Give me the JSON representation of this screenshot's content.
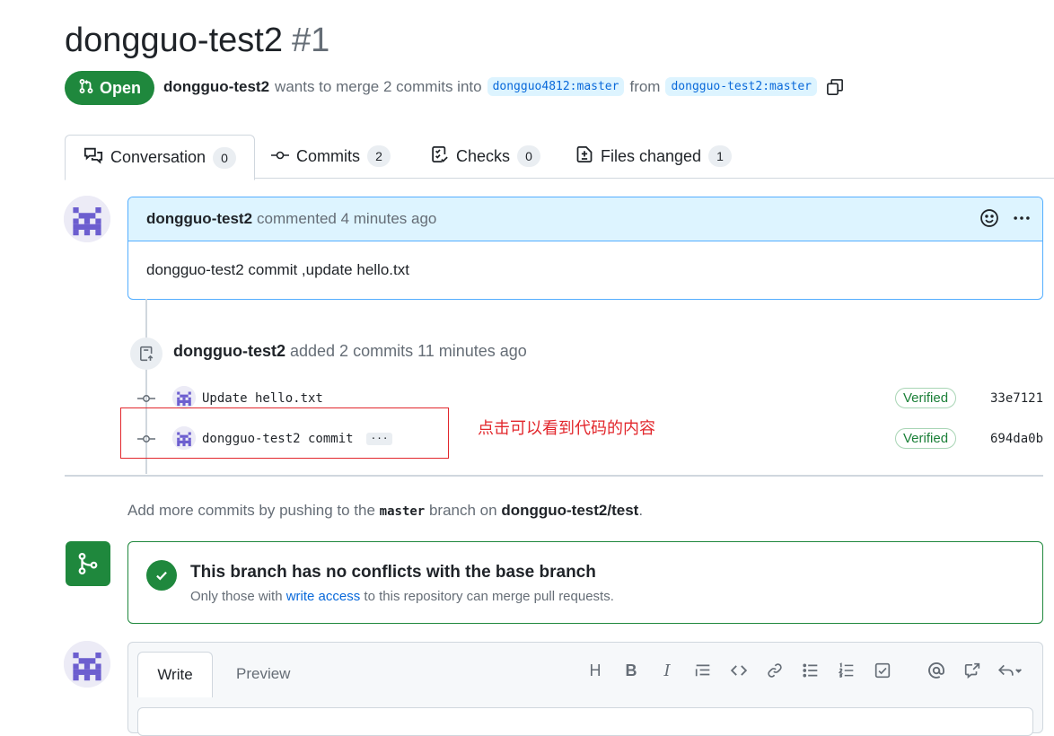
{
  "pr": {
    "title": "dongguo-test2",
    "number": "#1",
    "state": "Open",
    "author": "dongguo-test2",
    "wants_text": "wants to merge 2 commits into",
    "base_branch": "dongguo4812:master",
    "from_text": "from",
    "head_branch": "dongguo-test2:master"
  },
  "tabs": [
    {
      "label": "Conversation",
      "count": "0"
    },
    {
      "label": "Commits",
      "count": "2"
    },
    {
      "label": "Checks",
      "count": "0"
    },
    {
      "label": "Files changed",
      "count": "1"
    }
  ],
  "comment": {
    "author": "dongguo-test2",
    "meta": "commented 4 minutes ago",
    "body": "dongguo-test2 commit ,update hello.txt"
  },
  "event": {
    "author": "dongguo-test2",
    "text": "added 2 commits 11 minutes ago"
  },
  "commits": [
    {
      "message": "Update hello.txt",
      "verified": "Verified",
      "sha": "33e7121"
    },
    {
      "message": "dongguo-test2 commit",
      "verified": "Verified",
      "sha": "694da0b",
      "more": "···"
    }
  ],
  "annotation": "点击可以看到代码的内容",
  "hint": {
    "prefix": "Add more commits by pushing to the",
    "branch": "master",
    "middle": "branch on",
    "repo": "dongguo-test2/test",
    "suffix": "."
  },
  "merge": {
    "title": "This branch has no conflicts with the base branch",
    "sub_prefix": "Only those with",
    "sub_link": "write access",
    "sub_suffix": "to this repository can merge pull requests."
  },
  "editor": {
    "write_tab": "Write",
    "preview_tab": "Preview",
    "heading_glyph": "H",
    "bold_glyph": "B",
    "italic_glyph": "I"
  },
  "colors": {
    "accent_green": "#1f883d",
    "link_blue": "#0969da",
    "annotation_red": "#e2272c"
  }
}
